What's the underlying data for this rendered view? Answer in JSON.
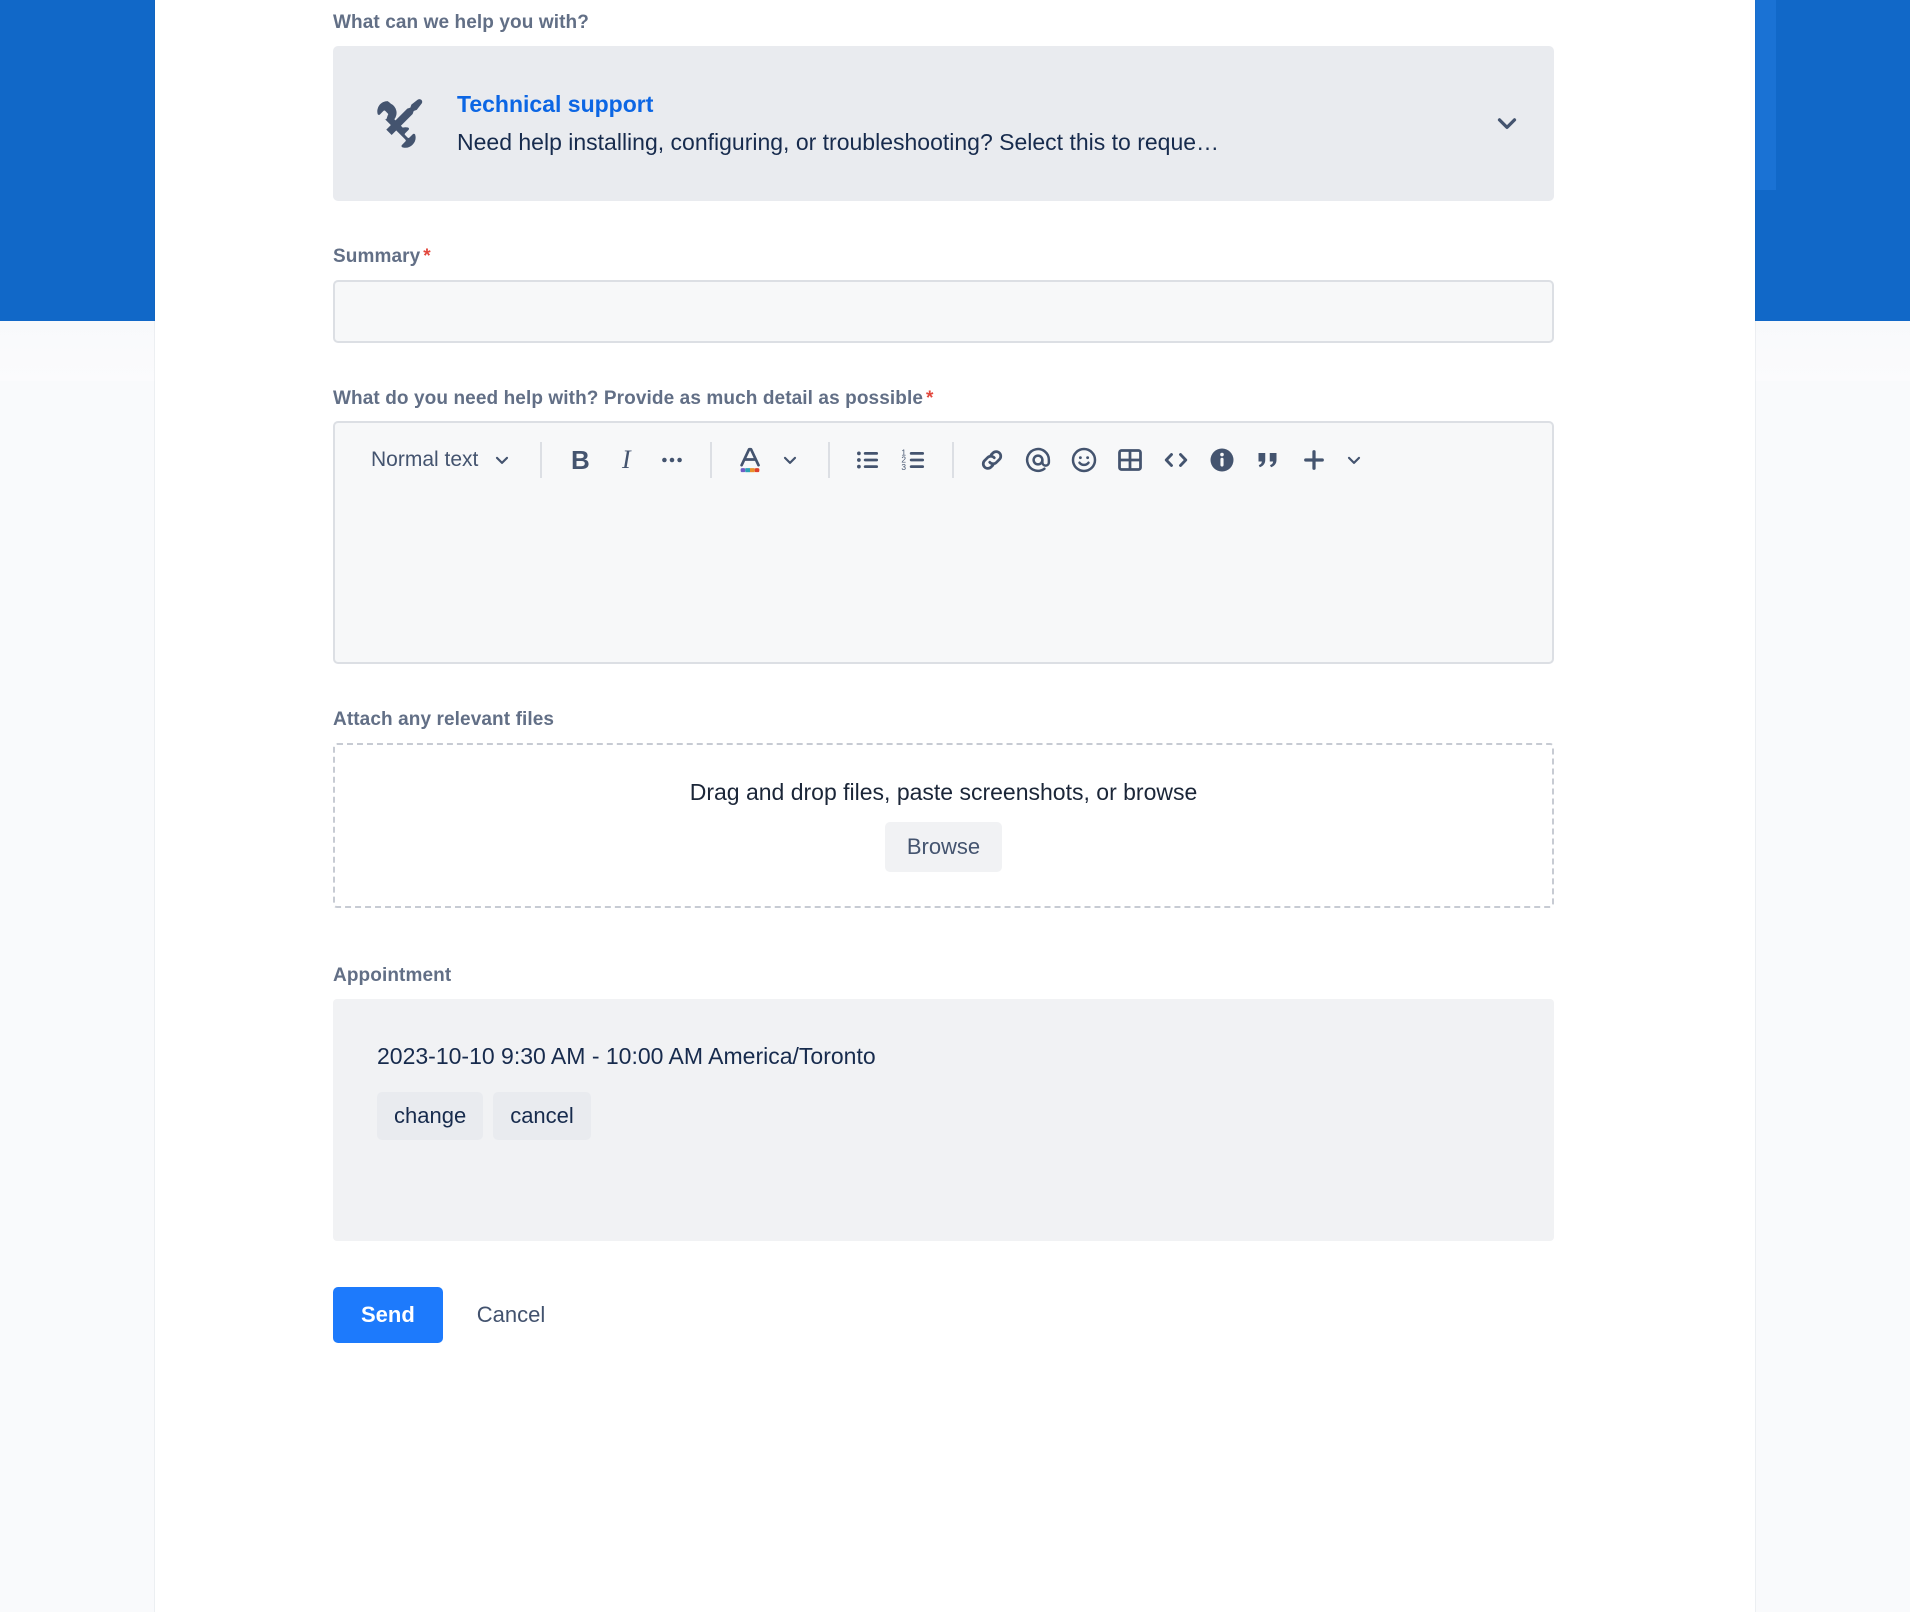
{
  "theme": {
    "banner_blue": "#1168C8",
    "banner_scroll_blue": "#1A72D4",
    "card_white": "#FFFFFF",
    "page_bg": "#F9FAFC",
    "link_blue": "#0C66E4",
    "primary_button_blue": "#1D7AFC",
    "label_grey": "#626F86",
    "text_dark": "#172B4D",
    "required_red": "#E2483D",
    "field_bg": "#F7F8F9",
    "field_border": "#DCDFE4",
    "panel_grey": "#F1F2F4",
    "selector_grey": "#E9EBEF"
  },
  "request_type": {
    "label": "What can we help you with?",
    "icon": "wrench-screwdriver-icon",
    "title": "Technical support",
    "description": "Need help installing, configuring, or troubleshooting? Select this to reque…",
    "chevron": "chevron-down-icon"
  },
  "summary": {
    "label": "Summary",
    "required_marker": "*",
    "value": "",
    "placeholder": ""
  },
  "description": {
    "label": "What do you need help with? Provide as much detail as possible",
    "required_marker": "*",
    "value": "",
    "toolbar": {
      "text_style": "Normal text",
      "text_style_chevron": "chevron-down-icon",
      "bold": "B",
      "italic": "I",
      "more_formatting": "…",
      "text_color": "A",
      "text_color_chevron": "chevron-down-icon",
      "bullet_list": "bullet-list-icon",
      "numbered_list": "numbered-list-icon",
      "link": "link-icon",
      "mention": "mention-at-icon",
      "emoji": "emoji-smiley-icon",
      "table": "table-icon",
      "code": "code-brackets-icon",
      "info_panel": "info-circle-icon",
      "quote": "quote-marks-icon",
      "insert_more": "plus-icon",
      "insert_more_chevron": "chevron-down-icon"
    }
  },
  "attachments": {
    "label": "Attach any relevant files",
    "dropzone_text": "Drag and drop files, paste screenshots, or browse",
    "browse_label": "Browse"
  },
  "appointment": {
    "label": "Appointment",
    "slot": "2023-10-10 9:30 AM - 10:00 AM America/Toronto",
    "change_label": "change",
    "cancel_label": "cancel"
  },
  "footer": {
    "send_label": "Send",
    "cancel_label": "Cancel"
  }
}
